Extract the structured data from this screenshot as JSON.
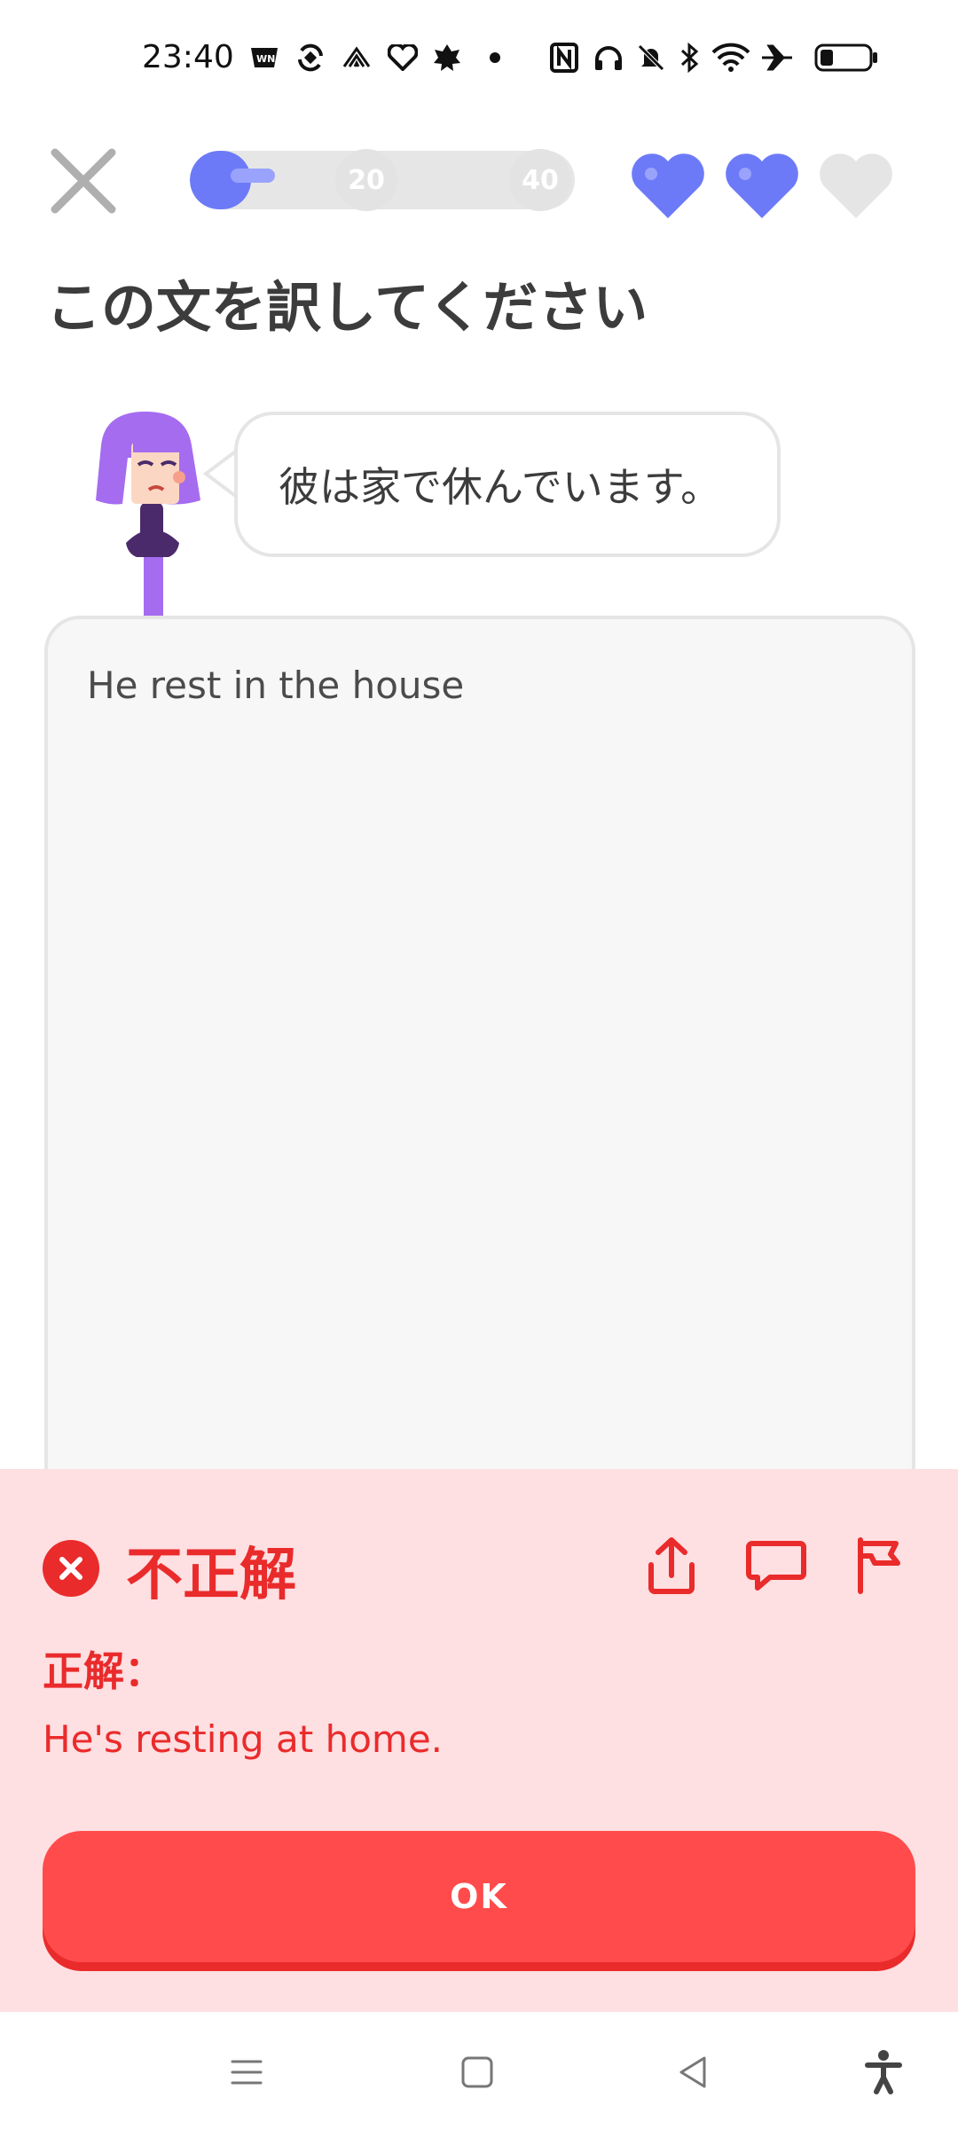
{
  "status_bar": {
    "time": "23:40",
    "icons": [
      "wn-app-icon",
      "sync-icon",
      "grid-app-icon",
      "heart-app-icon",
      "leaf-app-icon",
      "dot-icon",
      "nfc-icon",
      "headphones-icon",
      "mute-icon",
      "bluetooth-icon",
      "wifi-icon",
      "airplane-icon",
      "battery-icon"
    ]
  },
  "lesson_header": {
    "close_icon": "close-icon",
    "progress": {
      "fraction": 0.16,
      "milestones": [
        "20",
        "40"
      ]
    },
    "hearts": {
      "filled": 2,
      "total": 3,
      "color": "#6d7af7",
      "empty_color": "#e5e5e5"
    }
  },
  "prompt": {
    "title": "この文を訳してください",
    "sentence": "彼は家で休んでいます。"
  },
  "answer": {
    "text": "He rest in the house"
  },
  "feedback": {
    "status": "不正解",
    "correct_label": "正解：",
    "correct_answer": "He's resting at home.",
    "icons": [
      "share-icon",
      "comment-icon",
      "flag-icon"
    ],
    "ok_label": "OK",
    "colors": {
      "background": "#fedfe2",
      "accent": "#ea2b2b",
      "button": "#ff4b4b"
    }
  },
  "nav_bar": {
    "icons": [
      "menu-icon",
      "home-icon",
      "back-icon",
      "accessibility-icon"
    ]
  }
}
